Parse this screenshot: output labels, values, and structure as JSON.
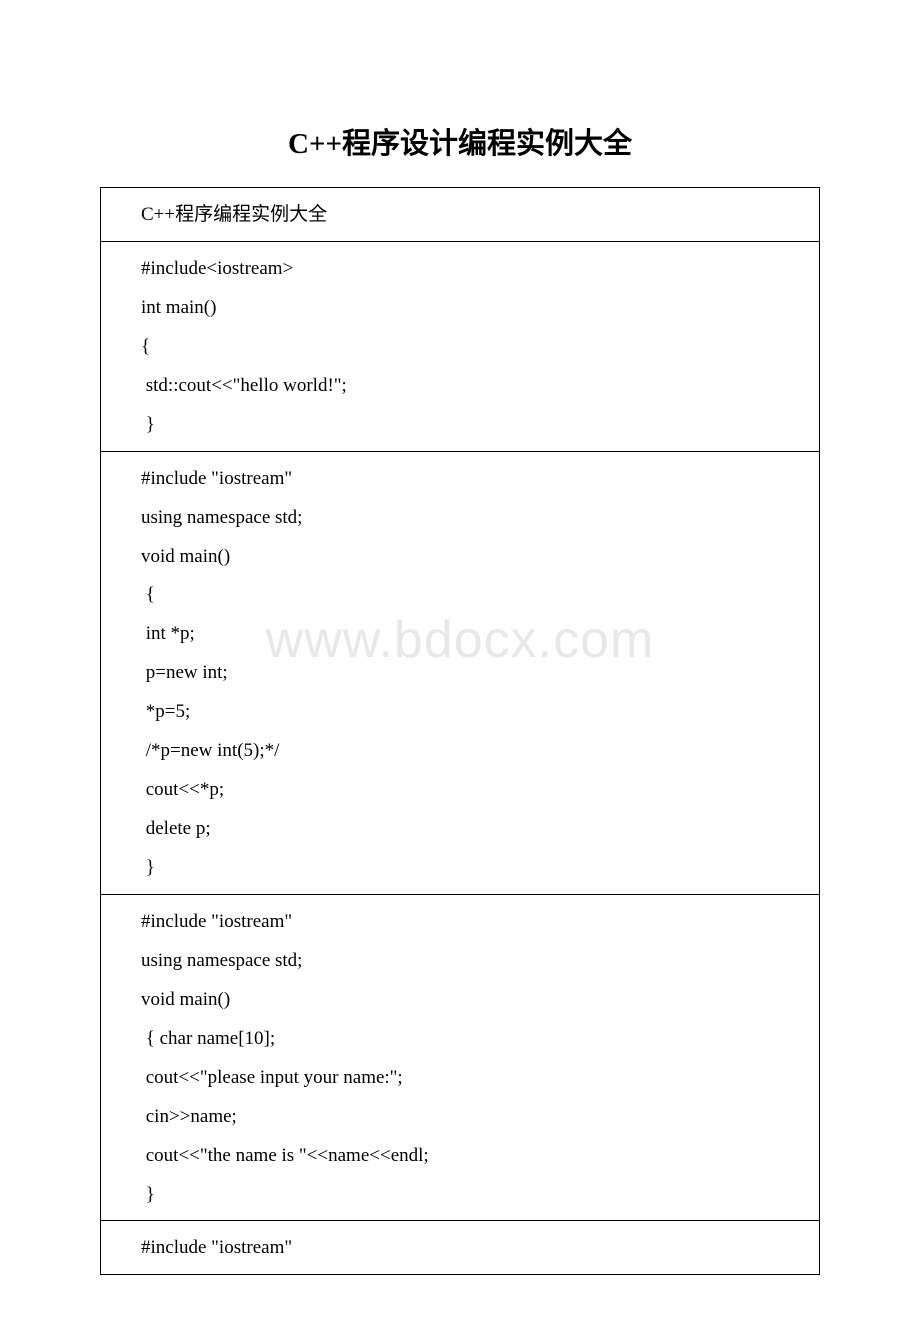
{
  "title": "C++程序设计编程实例大全",
  "watermark": "www.bdocx.com",
  "cells": [
    {
      "lines": [
        "C++程序编程实例大全"
      ]
    },
    {
      "lines": [
        "#include<iostream>",
        "int main()",
        "{",
        " std::cout<<\"hello world!\";",
        " }"
      ]
    },
    {
      "lines": [
        "#include \"iostream\"",
        "using namespace std;",
        "void main()",
        " {",
        " int *p;",
        " p=new int;",
        " *p=5;",
        " /*p=new int(5);*/",
        " cout<<*p;",
        " delete p;",
        " }"
      ]
    },
    {
      "lines": [
        "#include \"iostream\"",
        "using namespace std;",
        "void main()",
        " { char name[10];",
        " cout<<\"please input your name:\";",
        " cin>>name;",
        " cout<<\"the name is \"<<name<<endl;",
        " }"
      ]
    },
    {
      "lines": [
        "#include \"iostream\""
      ]
    }
  ]
}
